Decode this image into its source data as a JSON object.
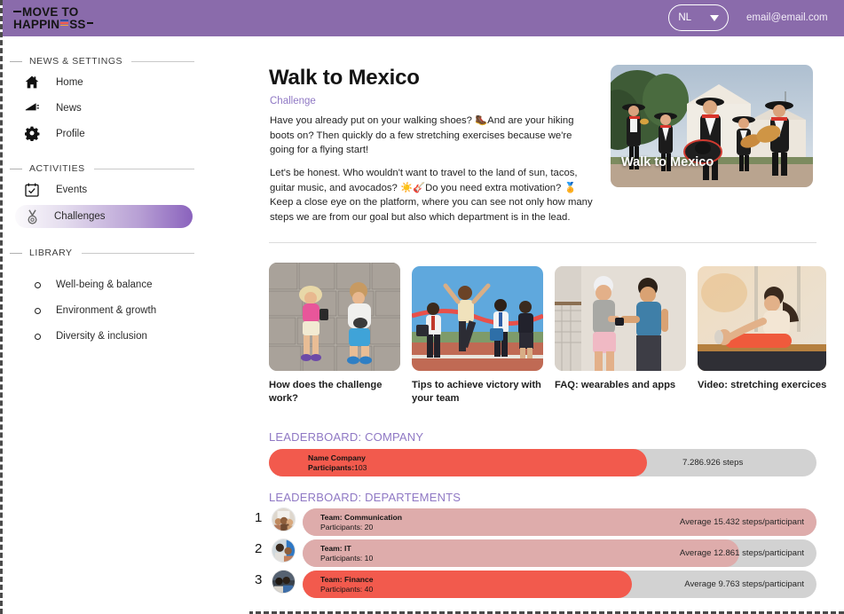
{
  "topbar": {
    "logo_line1": "MOVE TO",
    "logo_line2": "HAPPIN",
    "logo_line2_tail": "SS",
    "logo_alt": "MOVE TO HAPPINESS",
    "language": "NL",
    "email": "email@email.com",
    "bg_color": "#8a6bab"
  },
  "sidebar": {
    "sections": [
      {
        "title": "NEWS & SETTINGS",
        "items": [
          {
            "label": "Home",
            "icon": "home-icon",
            "active": false
          },
          {
            "label": "News",
            "icon": "megaphone-icon",
            "active": false
          },
          {
            "label": "Profile",
            "icon": "gear-icon",
            "active": false
          }
        ]
      },
      {
        "title": "ACTIVITIES",
        "items": [
          {
            "label": "Events",
            "icon": "calendar-check-icon",
            "active": false
          },
          {
            "label": "Challenges",
            "icon": "medal-icon",
            "active": true
          }
        ]
      },
      {
        "title": "LIBRARY",
        "items": [
          {
            "label": "Well-being & balance",
            "icon": "bullet-ring-icon",
            "active": false
          },
          {
            "label": "Environment & growth",
            "icon": "bullet-ring-icon",
            "active": false
          },
          {
            "label": "Diversity & inclusion",
            "icon": "bullet-ring-icon",
            "active": false
          }
        ]
      }
    ]
  },
  "main": {
    "title": "Walk to Mexico",
    "subtitle": "Challenge",
    "paragraph1": "Have you already put on your walking shoes? 🥾And are your hiking boots on? Then quickly do a few stretching exercises because we're going for a flying start!",
    "paragraph2": "Let's be honest. Who wouldn't want to travel to the land of sun, tacos, guitar music, and avocados? ☀️🎸Do you need extra motivation? 🏅Keep a close eye on the platform, where you can see not only how many steps we are from our goal but also which department is in the lead.",
    "hero": {
      "caption": "Walk to Mexico",
      "alt": "Mariachi band playing in front of a white church"
    },
    "cards": [
      {
        "caption": "How does the challenge work?",
        "alt": "Overhead view of two people walking on cobblestones"
      },
      {
        "caption": "Tips to achieve victory with your team",
        "alt": "Business people crossing a finish-line ribbon"
      },
      {
        "caption": "FAQ: wearables and apps",
        "alt": "Two people checking a fitness watch"
      },
      {
        "caption": "Video: stretching exercices",
        "alt": "Woman stretching on an exercise mat"
      }
    ]
  },
  "leaderboard_company": {
    "title": "LEADERBOARD: COMPANY",
    "row": {
      "name": "Name Company",
      "participants_label": "Participants:",
      "participants": "103",
      "steps": "7.286.926 steps",
      "fill_percent": 68,
      "fill_color": "#f25a4d"
    }
  },
  "leaderboard_departments": {
    "title": "LEADERBOARD: DEPARTEMENTS",
    "rows": [
      {
        "rank": "1",
        "name": "Team: Communication",
        "participants_label": "Participants: 20",
        "steps": "Average 15.432 steps/participant",
        "fill_percent": 100,
        "fill_color": "#deacab",
        "avatar_alt": "Team photo"
      },
      {
        "rank": "2",
        "name": "Team: IT",
        "participants_label": "Participants: 10",
        "steps": "Average 12.861 steps/participant",
        "fill_percent": 85,
        "fill_color": "#deacab",
        "avatar_alt": "Team photo"
      },
      {
        "rank": "3",
        "name": "Team: Finance",
        "participants_label": "Participants: 40",
        "steps": "Average 9.763 steps/participant",
        "fill_percent": 64,
        "fill_color": "#f25a4d",
        "avatar_alt": "Team photo"
      }
    ]
  },
  "colors": {
    "brand_purple": "#8a6bab",
    "accent_purple": "#8f78c4",
    "coral": "#f25a4d",
    "muted_rose": "#deacab",
    "track_gray": "#d2d2d2"
  }
}
